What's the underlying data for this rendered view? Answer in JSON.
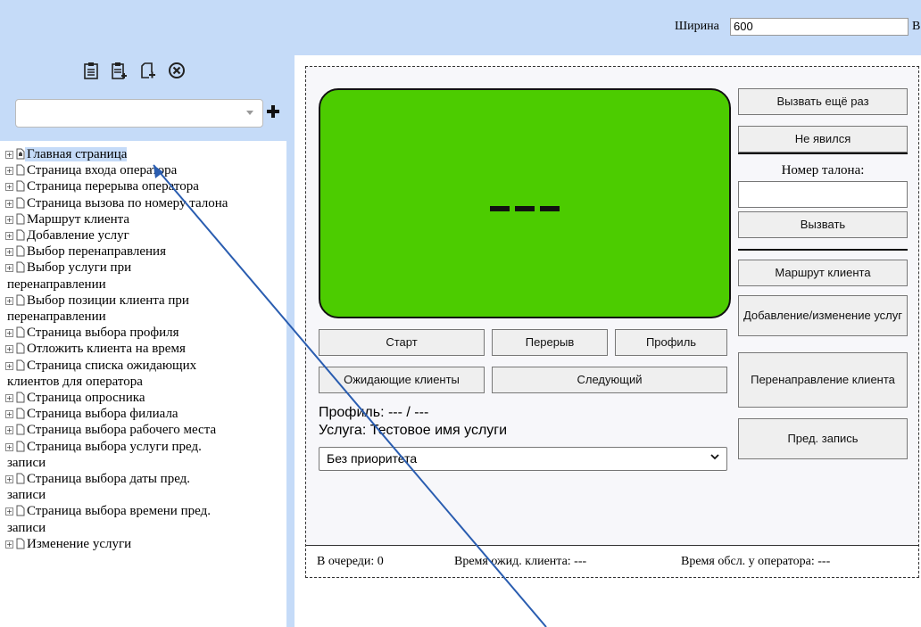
{
  "topbar": {
    "width_label": "Ширина",
    "width_value": "600",
    "trailing_label": "В"
  },
  "toolbar": {
    "icons": [
      "clipboard-icon",
      "clipboard-add-icon",
      "page-add-icon",
      "close-circle-icon"
    ],
    "combo_value": "",
    "add_icon": "plus-icon"
  },
  "tree": {
    "items": [
      {
        "label": "Главная страница",
        "selected": true
      },
      {
        "label": "Страница входа оператора"
      },
      {
        "label": "Страница перерыва оператора"
      },
      {
        "label": "Страница вызова по номеру талона"
      },
      {
        "label": "Маршрут клиента"
      },
      {
        "label": "Добавление услуг"
      },
      {
        "label": "Выбор перенаправления"
      },
      {
        "label": "Выбор услуги при",
        "cont": "перенаправлении"
      },
      {
        "label": "Выбор позиции клиента при",
        "cont": "перенаправлении"
      },
      {
        "label": "Страница выбора профиля"
      },
      {
        "label": "Отложить клиента на время"
      },
      {
        "label": "Страница списка ожидающих",
        "cont": "клиентов для оператора"
      },
      {
        "label": "Страница опросника"
      },
      {
        "label": "Страница выбора филиала"
      },
      {
        "label": "Страница выбора рабочего места"
      },
      {
        "label": "Страница выбора услуги пред.",
        "cont": "записи"
      },
      {
        "label": "Страница выбора даты пред.",
        "cont": "записи"
      },
      {
        "label": "Страница выбора времени пред.",
        "cont": "записи"
      },
      {
        "label": "Изменение услуги"
      }
    ]
  },
  "operator": {
    "display": "---",
    "display_color": "#4ccc00",
    "buttons": {
      "call_again": "Вызвать ещё раз",
      "no_show": "Не явился",
      "ticket_label": "Номер талона:",
      "call": "Вызвать",
      "client_route": "Маршрут клиента",
      "add_change_services": "Добавление/изменение услуг",
      "redirect_client": "Перенаправление клиента",
      "pre_booking": "Пред. запись",
      "start": "Старт",
      "break": "Перерыв",
      "profile": "Профиль",
      "waiting_clients": "Ожидающие клиенты",
      "next": "Следующий"
    },
    "profile_text": "Профиль: --- / ---",
    "service_text": "Услуга: Тестовое имя услуги",
    "priority_select": "Без приоритета",
    "status": {
      "queue": "В очереди: 0",
      "wait_time": "Время ожид. клиента: ---",
      "service_time": "Время обсл. у оператора: ---"
    }
  }
}
